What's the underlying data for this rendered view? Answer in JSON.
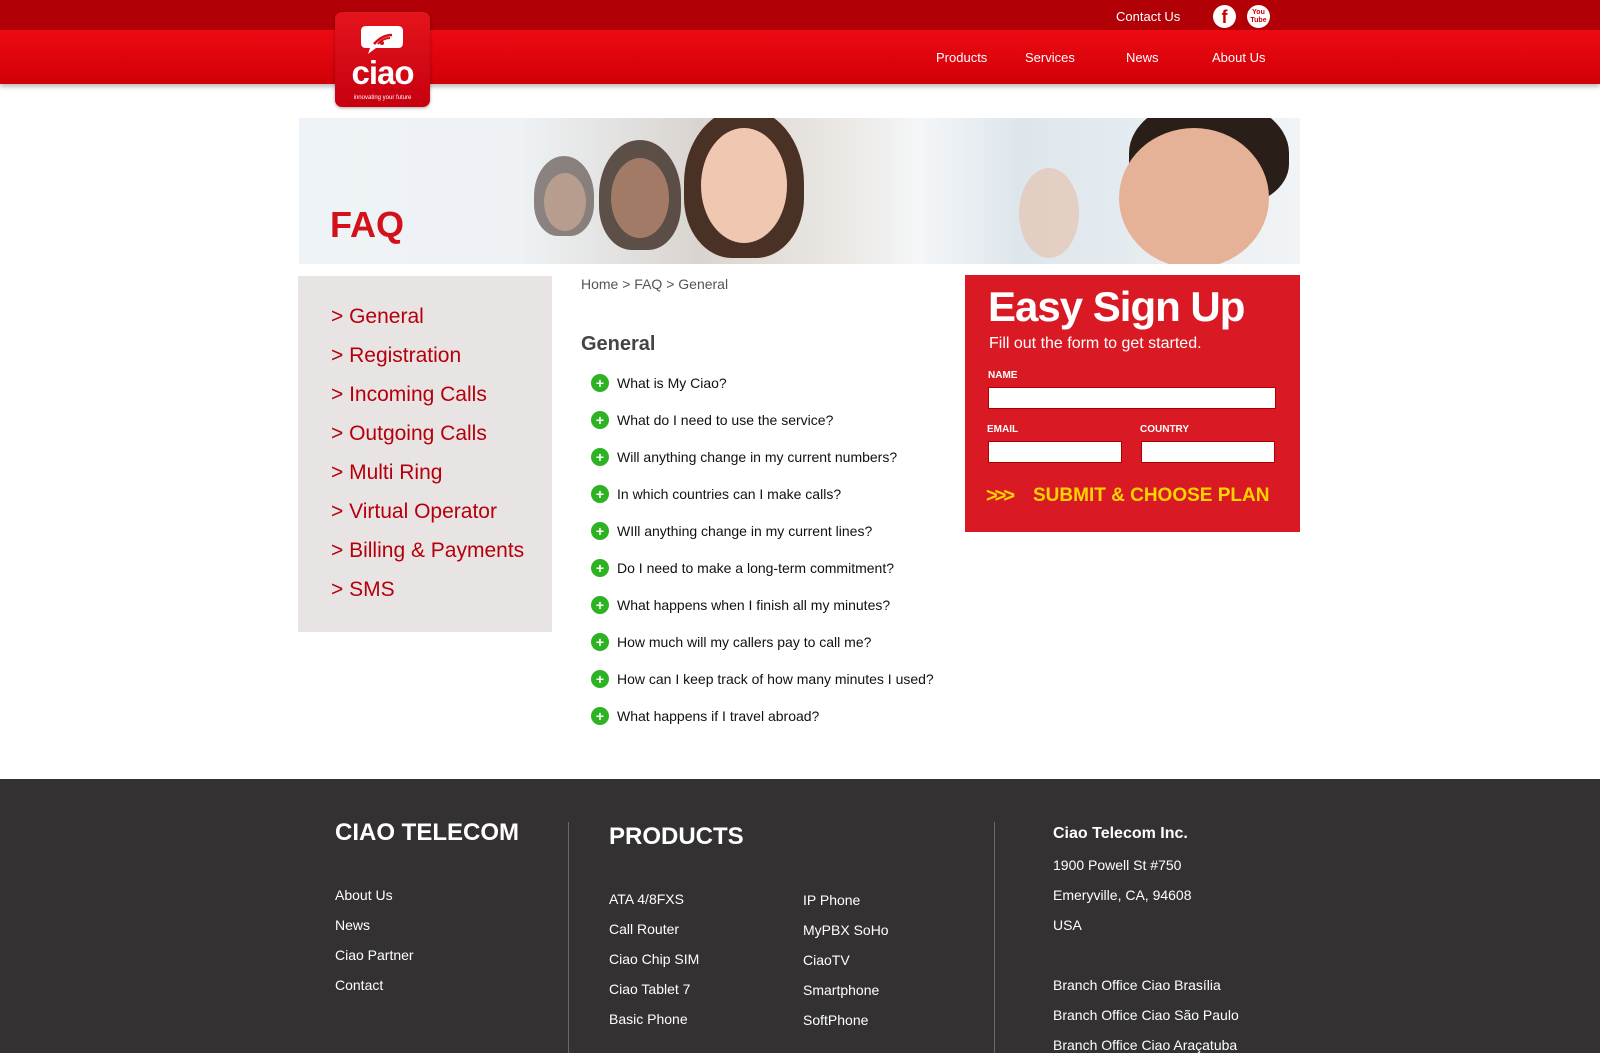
{
  "header": {
    "logo": {
      "word": "ciao",
      "tagline": "innovating your future"
    },
    "contact_label": "Contact Us",
    "social": [
      {
        "name": "facebook-icon",
        "glyph": "f"
      },
      {
        "name": "youtube-icon",
        "glyph": "You Tube"
      }
    ],
    "nav": [
      "Products",
      "Services",
      "News",
      "About Us"
    ]
  },
  "banner": {
    "title": "FAQ"
  },
  "sidebar": {
    "items": [
      {
        "label": "> General"
      },
      {
        "label": "> Registration"
      },
      {
        "label": "> Incoming Calls"
      },
      {
        "label": "> Outgoing Calls"
      },
      {
        "label": "> Multi Ring"
      },
      {
        "label": "> Virtual Operator"
      },
      {
        "label": "> Billing & Payments"
      },
      {
        "label": "> SMS"
      }
    ]
  },
  "main": {
    "breadcrumb": "Home > FAQ > General",
    "section_title": "General",
    "faq": [
      "What is My Ciao?",
      "What do I need to use the service?",
      "Will anything change in my current numbers?",
      "In which countries can I make calls?",
      "WIll anything change in my current lines?",
      "Do I need to make a long-term commitment?",
      "What happens when I finish all my minutes?",
      "How much will my callers pay to call me?",
      "How can I keep track of how many minutes I used?",
      "What happens if I travel abroad?"
    ],
    "faq_icon": "+"
  },
  "signup": {
    "title": "Easy Sign Up",
    "subtitle": "Fill out the form to get started.",
    "name_label": "NAME",
    "name_value": "",
    "email_label": "EMAIL",
    "email_value": "",
    "country_label": "COUNTRY",
    "country_value": "",
    "submit_label": "SUBMIT & CHOOSE PLAN",
    "submit_icon": ">>>"
  },
  "footer": {
    "company_title": "CIAO TELECOM",
    "company_links": [
      "About Us",
      "News",
      "Ciao Partner",
      "Contact"
    ],
    "products_title": "PRODUCTS",
    "products_col1": [
      "ATA 4/8FXS",
      "Call Router",
      "Ciao Chip SIM",
      "Ciao Tablet 7",
      "Basic Phone"
    ],
    "products_col2": [
      "IP Phone",
      "MyPBX SoHo",
      "CiaoTV",
      "Smartphone",
      "SoftPhone"
    ],
    "address_title": "Ciao Telecom Inc.",
    "address_lines": [
      "1900 Powell St #750",
      "Emeryville, CA, 94608",
      "USA"
    ],
    "branches": [
      "Branch Office Ciao Brasília",
      "Branch Office Ciao São Paulo",
      "Branch Office Ciao Araçatuba"
    ]
  },
  "colors": {
    "brand_red": "#d91a24",
    "header_dark_red": "#b10006",
    "sidebar_bg": "#e9e4e4",
    "faq_icon_green": "#2db224",
    "cta_yellow": "#ffd400",
    "footer_bg": "#333132"
  }
}
